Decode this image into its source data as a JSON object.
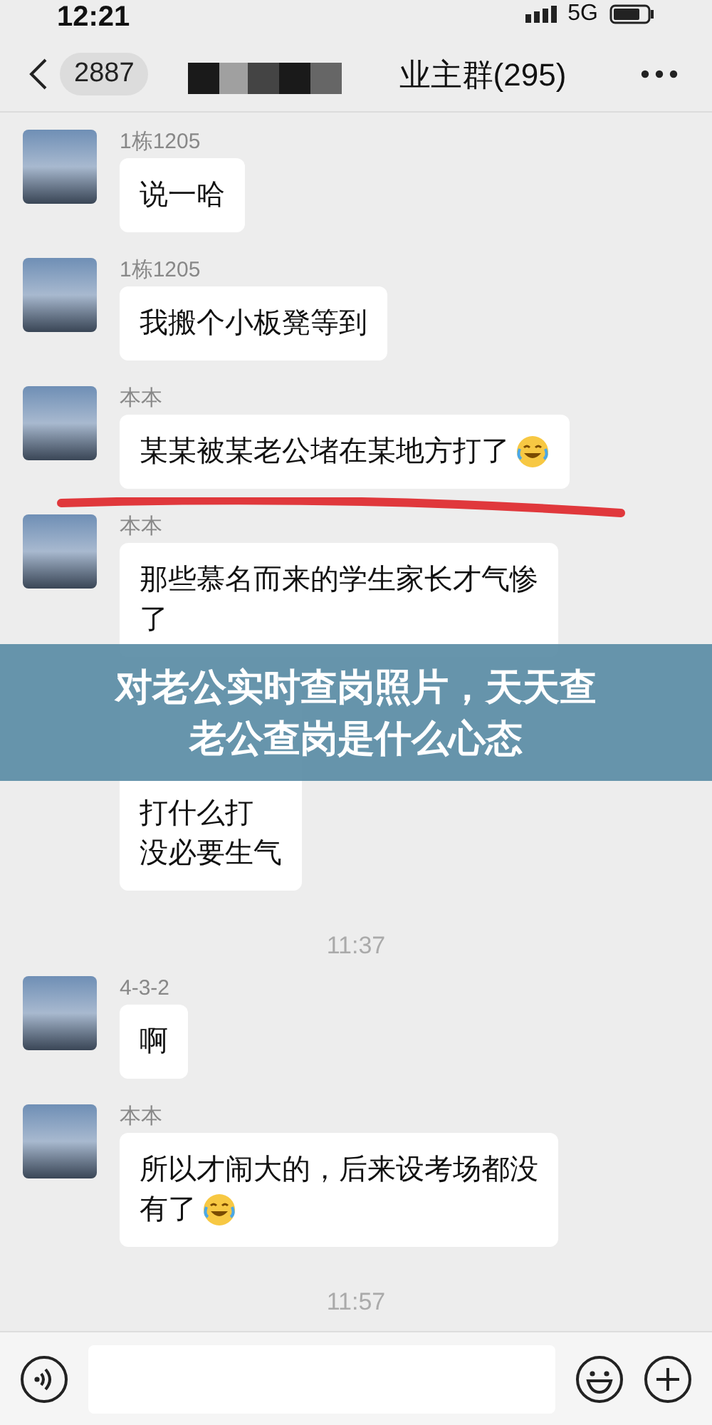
{
  "status_bar": {
    "time": "12:21",
    "network": "5G"
  },
  "header": {
    "back_count": "2887",
    "title": "业主群(295)"
  },
  "messages": [
    {
      "kind": "message",
      "sender": "1栋1205",
      "lines": [
        "说一哈"
      ],
      "emoji": false,
      "underlined": false
    },
    {
      "kind": "message",
      "sender": "1栋1205",
      "lines": [
        "我搬个小板凳等到"
      ],
      "emoji": false,
      "underlined": false
    },
    {
      "kind": "message",
      "sender": "本本",
      "lines": [
        "某某被某老公堵在某地方打了"
      ],
      "emoji": true,
      "underlined": true
    },
    {
      "kind": "message",
      "sender": "本本",
      "lines": [
        "那些慕名而来的学生家长才气惨",
        "了"
      ],
      "emoji": false,
      "underlined": false
    },
    {
      "kind": "covered",
      "lines": [
        "打什么打",
        "没必要生气"
      ]
    },
    {
      "kind": "time",
      "text": "11:37"
    },
    {
      "kind": "message",
      "sender": "4-3-2",
      "lines": [
        "啊"
      ],
      "emoji": false,
      "underlined": false
    },
    {
      "kind": "message",
      "sender": "本本",
      "lines": [
        "所以才闹大的，后来设考场都没",
        "有了"
      ],
      "emoji": true,
      "underlined": false
    },
    {
      "kind": "time",
      "text": "11:57"
    }
  ],
  "banner": {
    "title": "对老公实时查岗照片，天天查老公查岗是什么心态"
  }
}
